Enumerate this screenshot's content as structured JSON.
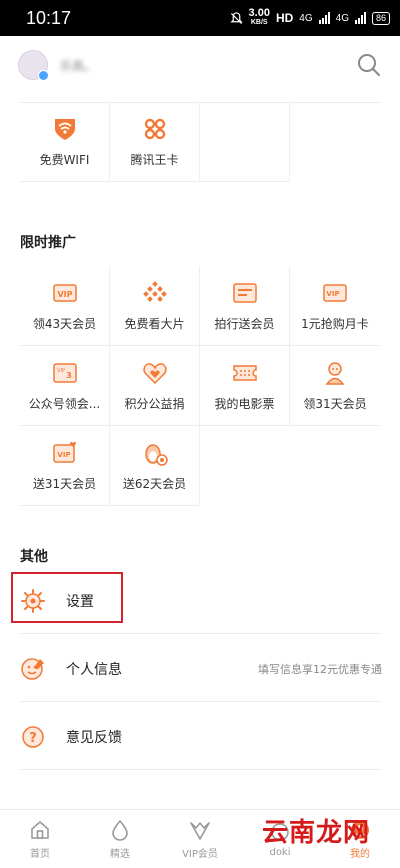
{
  "status": {
    "time": "10:17",
    "speed_value": "3.00",
    "speed_unit": "KB/S",
    "hd": "HD",
    "net1": "4G",
    "net2": "4G",
    "battery": "86"
  },
  "header": {
    "username": "乐高。"
  },
  "services": [
    {
      "label": "免费WIFI",
      "icon": "wifi-shield-icon"
    },
    {
      "label": "腾讯王卡",
      "icon": "knot-icon"
    }
  ],
  "promo": {
    "title": "限时推广",
    "items": [
      {
        "label": "领43天会员",
        "icon": "vip-ticket-icon"
      },
      {
        "label": "免费看大片",
        "icon": "dots-diamond-icon"
      },
      {
        "label": "拍行送会员",
        "icon": "card-icon"
      },
      {
        "label": "1元抢购月卡",
        "icon": "vip-card-icon"
      },
      {
        "label": "公众号领会...",
        "icon": "vip-3-card-icon"
      },
      {
        "label": "积分公益捐",
        "icon": "heart-icon"
      },
      {
        "label": "我的电影票",
        "icon": "ticket-icon"
      },
      {
        "label": "领31天会员",
        "icon": "character-icon"
      },
      {
        "label": "送31天会员",
        "icon": "vip-heart-card-icon"
      },
      {
        "label": "送62天会员",
        "icon": "penguin-icon"
      }
    ]
  },
  "other": {
    "title": "其他",
    "items": [
      {
        "label": "设置",
        "icon": "gear-icon",
        "hint": ""
      },
      {
        "label": "个人信息",
        "icon": "person-edit-icon",
        "hint": "填写信息享12元优惠专通"
      },
      {
        "label": "意见反馈",
        "icon": "question-icon",
        "hint": ""
      }
    ]
  },
  "tabs": [
    {
      "label": "首页",
      "icon": "home-icon"
    },
    {
      "label": "精选",
      "icon": "drop-icon"
    },
    {
      "label": "VIP会员",
      "icon": "vip-crown-icon"
    },
    {
      "label": "doki",
      "icon": "doki-icon"
    },
    {
      "label": "我的",
      "icon": "profile-icon"
    }
  ],
  "watermark": "云南龙网",
  "colors": {
    "accent": "#f07a36",
    "highlight": "#d3242d"
  }
}
